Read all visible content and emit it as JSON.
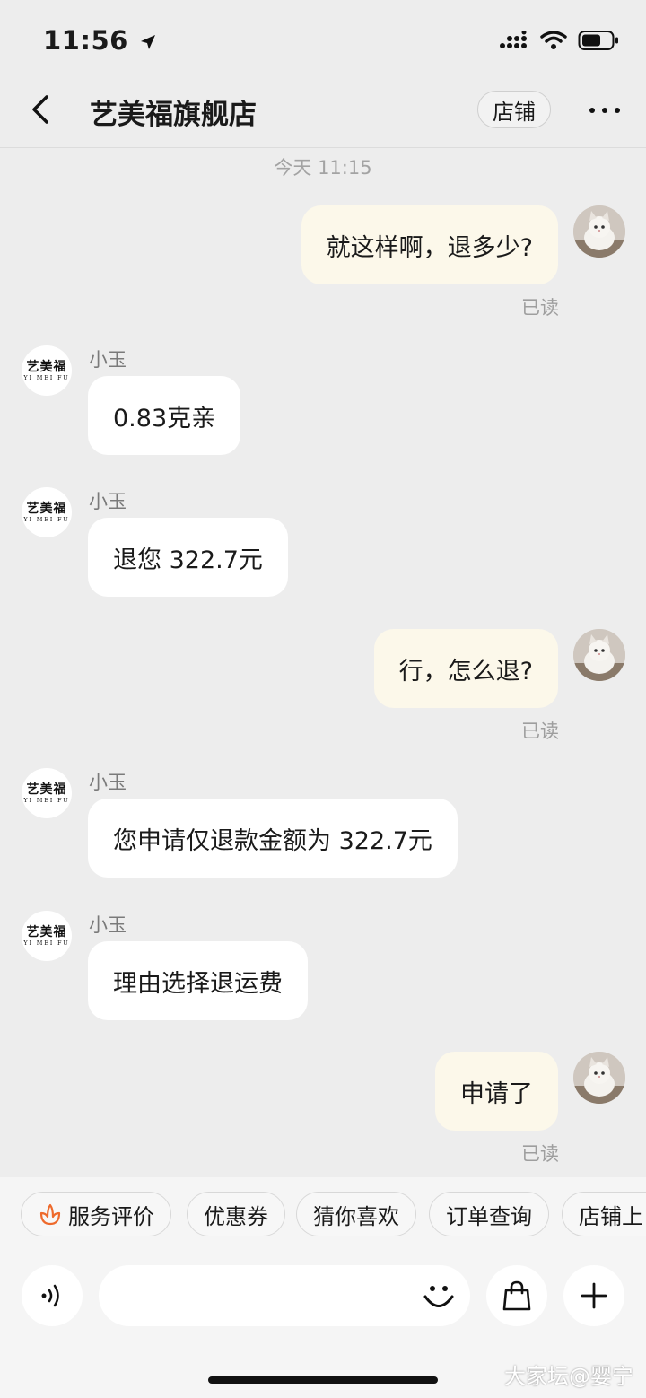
{
  "status_bar": {
    "time": "11:56"
  },
  "header": {
    "title": "艺美福旗舰店",
    "shop_button": "店铺"
  },
  "chat": {
    "timestamp": "今天 11:15",
    "read_label": "已读",
    "sender_name": "小玉",
    "shop_avatar": {
      "zh": "艺美福",
      "en": "YI MEI FU"
    },
    "messages": [
      {
        "from": "me",
        "text": "就这样啊，退多少?"
      },
      {
        "from": "them",
        "text": "0.83克亲"
      },
      {
        "from": "them",
        "text": "退您 322.7元"
      },
      {
        "from": "me",
        "text": "行，怎么退?"
      },
      {
        "from": "them",
        "text": "您申请仅退款金额为 322.7元"
      },
      {
        "from": "them",
        "text": "理由选择退运费"
      },
      {
        "from": "me",
        "text": "申请了"
      }
    ]
  },
  "quick_actions": [
    "服务评价",
    "优惠券",
    "猜你喜欢",
    "订单查询",
    "店铺上"
  ],
  "input": {
    "placeholder": ""
  },
  "watermark": "大家坛@婴宁",
  "colors": {
    "my_bubble": "#fcf8ea",
    "their_bubble": "#ffffff",
    "background": "#ededed",
    "accent_icon": "#ee6a2c"
  }
}
